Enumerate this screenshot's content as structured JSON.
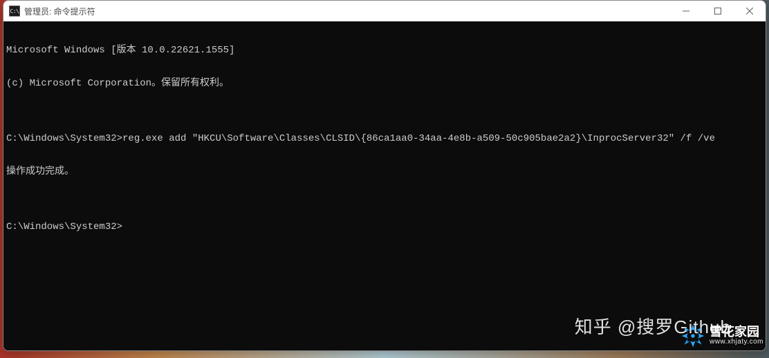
{
  "window": {
    "title": "管理员: 命令提示符",
    "icon_label": "C:\\"
  },
  "terminal": {
    "lines": [
      "Microsoft Windows [版本 10.0.22621.1555]",
      "(c) Microsoft Corporation。保留所有权利。",
      "",
      "C:\\Windows\\System32>reg.exe add \"HKCU\\Software\\Classes\\CLSID\\{86ca1aa0-34aa-4e8b-a509-50c905bae2a2}\\InprocServer32\" /f /ve",
      "操作成功完成。",
      "",
      "C:\\Windows\\System32>"
    ]
  },
  "watermarks": {
    "zhihu": "知乎 @搜罗Github",
    "brand_name": "雪花家园",
    "brand_url": "www.xhjaty.com"
  }
}
